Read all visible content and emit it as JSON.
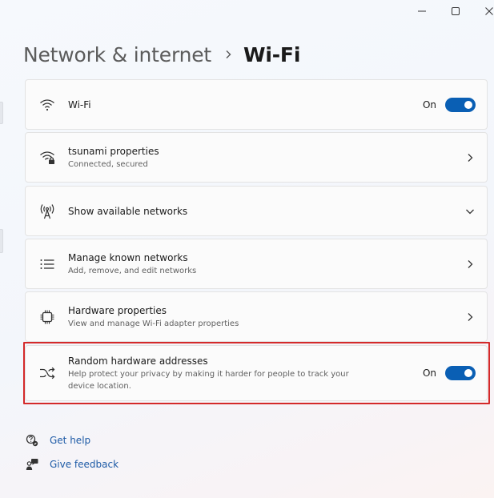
{
  "window": {
    "controls": [
      "minimize-icon",
      "maximize-icon",
      "close-icon"
    ]
  },
  "breadcrumb": {
    "parent": "Network & internet",
    "separator_icon": "chevron-right-icon",
    "current": "Wi-Fi"
  },
  "cards": {
    "wifi": {
      "icon": "wifi-icon",
      "title": "Wi-Fi",
      "state": "On",
      "toggle_on": true
    },
    "properties": {
      "icon": "wifi-lock-icon",
      "title": "tsunami properties",
      "desc": "Connected, secured",
      "action_icon": "chevron-right-icon"
    },
    "available": {
      "icon": "antenna-icon",
      "title": "Show available networks",
      "action_icon": "chevron-down-icon"
    },
    "known": {
      "icon": "list-icon",
      "title": "Manage known networks",
      "desc": "Add, remove, and edit networks",
      "action_icon": "chevron-right-icon"
    },
    "hardware": {
      "icon": "chip-icon",
      "title": "Hardware properties",
      "desc": "View and manage Wi-Fi adapter properties",
      "action_icon": "chevron-right-icon"
    },
    "random": {
      "icon": "shuffle-icon",
      "title": "Random hardware addresses",
      "desc": "Help protect your privacy by making it harder for people to track your device location.",
      "state": "On",
      "toggle_on": true
    }
  },
  "links": {
    "help": {
      "icon": "help-icon",
      "label": "Get help"
    },
    "feedback": {
      "icon": "feedback-icon",
      "label": "Give feedback"
    }
  },
  "colors": {
    "accent": "#0a5fb4",
    "link": "#1d5aa6",
    "highlight_border": "#d42a2a"
  }
}
